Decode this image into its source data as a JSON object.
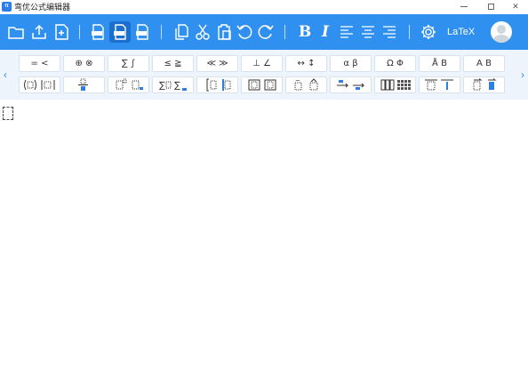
{
  "window": {
    "title": "弯优公式编辑器",
    "app_icon_text": "π",
    "buttons": [
      "minimize",
      "maximize",
      "close"
    ],
    "close_glyph": "✕"
  },
  "toolbar": {
    "background": "#3090f0",
    "groups": [
      [
        "open-folder-icon",
        "upload-icon",
        "new-file-icon"
      ],
      [
        "export-png-icon",
        "export-jpg-icon",
        "export-tex-icon"
      ],
      [
        "copy-icon",
        "cut-icon",
        "paste-icon",
        "undo-icon",
        "redo-icon"
      ],
      [
        "bold",
        "italic",
        "align-left",
        "align-center",
        "align-right"
      ],
      [
        "settings-icon",
        "latex",
        "user-avatar"
      ]
    ],
    "bold_label": "B",
    "italic_label": "I",
    "latex_label": "LaTeX",
    "active_tool": "export-jpg-icon"
  },
  "palette": {
    "nav_left": "‹",
    "nav_right": "›",
    "row1": [
      "= <",
      "⊕ ⊗",
      "∑ ∫",
      "≤ ≧",
      "≪ ≫",
      "⊥ ∠",
      "↔ ↕",
      "α β",
      "Ω Φ",
      "Å B",
      "A B"
    ],
    "row2_icons": [
      "bracket-templates-icon",
      "fraction-templates-icon",
      "script-templates-icon",
      "sum-templates-icon",
      "integral-templates-icon",
      "box-templates-icon",
      "accent-templates-icon",
      "arrow-templates-icon",
      "matrix-templates-icon",
      "bar-templates-icon",
      "vector-templates-icon"
    ]
  },
  "editor": {
    "placeholder_slot": "empty-input-slot"
  }
}
